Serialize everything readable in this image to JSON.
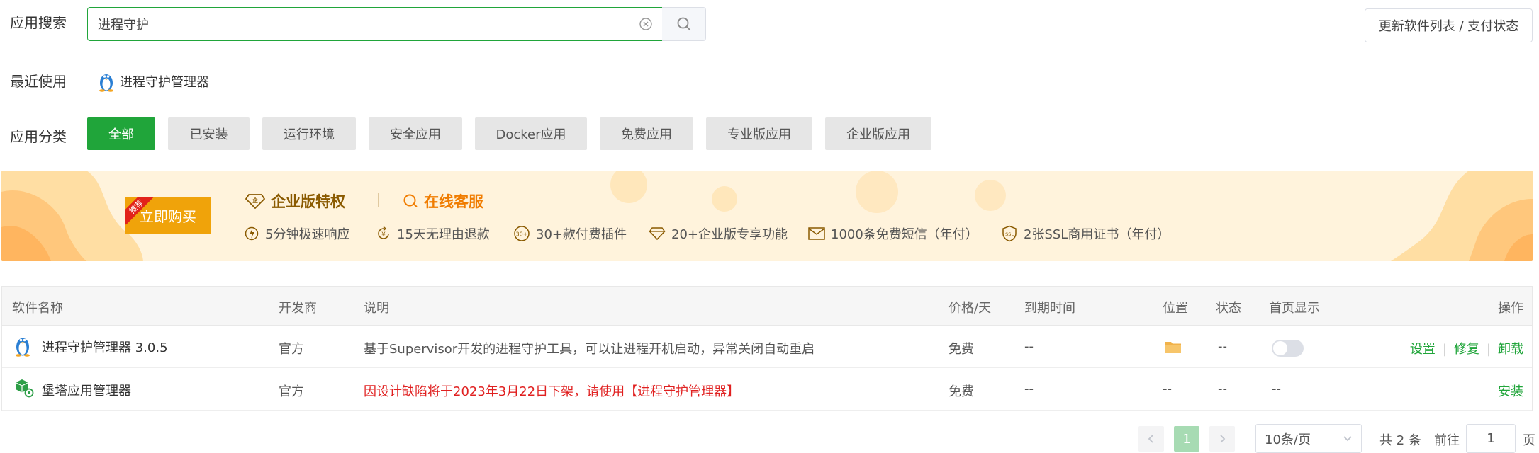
{
  "search": {
    "label": "应用搜索",
    "value": "进程守护",
    "update_button": "更新软件列表 / 支付状态"
  },
  "recent": {
    "label": "最近使用",
    "items": [
      "进程守护管理器"
    ]
  },
  "categories": {
    "label": "应用分类",
    "items": [
      "全部",
      "已安装",
      "运行环境",
      "安全应用",
      "Docker应用",
      "免费应用",
      "专业版应用",
      "企业版应用"
    ],
    "active": "全部"
  },
  "banner": {
    "buy_label": "立即购买",
    "ribbon": "推荐",
    "title_enterprise": "企业版特权",
    "title_service": "在线客服",
    "features": [
      "5分钟极速响应",
      "15天无理由退款",
      "30+款付费插件",
      "20+企业版专享功能",
      "1000条免费短信（年付）",
      "2张SSL商用证书（年付）"
    ],
    "feature_badge_30": "30+",
    "feature_badge_ssl": "SSL"
  },
  "table": {
    "headers": [
      "软件名称",
      "开发商",
      "说明",
      "价格/天",
      "到期时间",
      "位置",
      "状态",
      "首页显示",
      "操作"
    ],
    "rows": [
      {
        "name": "进程守护管理器 3.0.5",
        "developer": "官方",
        "description": "基于Supervisor开发的进程守护工具，可以让进程开机启动，异常关闭自动重启",
        "price": "免费",
        "expire": "--",
        "status": "--",
        "actions": [
          "设置",
          "修复",
          "卸载"
        ]
      },
      {
        "name": "堡塔应用管理器",
        "developer": "官方",
        "description": "因设计缺陷将于2023年3月22日下架，请使用【进程守护管理器】",
        "price": "免费",
        "expire": "--",
        "location": "--",
        "status": "--",
        "homepage": "--",
        "actions": [
          "安装"
        ]
      }
    ]
  },
  "pagination": {
    "current_page": "1",
    "page_size": "10条/页",
    "total": "共 2 条",
    "goto_label": "前往",
    "goto_value": "1",
    "page_suffix": "页"
  },
  "colors": {
    "primary": "#20a53a",
    "banner_bg": "#fff3dc",
    "buy_button": "#f0a30a",
    "warning_text": "#e02020"
  }
}
